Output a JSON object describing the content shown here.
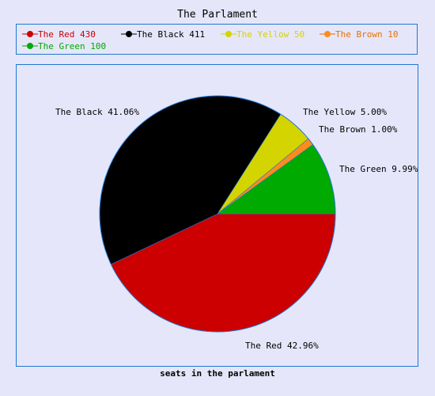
{
  "chart_data": {
    "type": "pie",
    "title": "The Parlament",
    "xlabel": "seats in the parlament",
    "legend_placement": "top",
    "slices": [
      {
        "name": "The Red",
        "value": 430,
        "percent_label": "42.96%",
        "color": "#cc0000",
        "legend_color": "#cc0000"
      },
      {
        "name": "The Black",
        "value": 411,
        "percent_label": "41.06%",
        "color": "#000000",
        "legend_color": "#000000"
      },
      {
        "name": "The Yellow",
        "value": 50,
        "percent_label": "5.00%",
        "color": "#d4d400",
        "legend_color": "#d4d400"
      },
      {
        "name": "The Brown",
        "value": 10,
        "percent_label": "1.00%",
        "color": "#ff8c1a",
        "legend_color": "#e67300"
      },
      {
        "name": "The Green",
        "value": 100,
        "percent_label": "9.99%",
        "color": "#00aa00",
        "legend_color": "#00aa00"
      }
    ],
    "legend": [
      "The Red 430",
      "The Black 411",
      "The Yellow 50",
      "The Brown 10",
      "The Green 100"
    ],
    "slice_labels": [
      "The Red 42.96%",
      "The Black 41.06%",
      "The Yellow 5.00%",
      "The Brown 1.00%",
      "The Green 9.99%"
    ],
    "border_color": "#1f78d1"
  }
}
